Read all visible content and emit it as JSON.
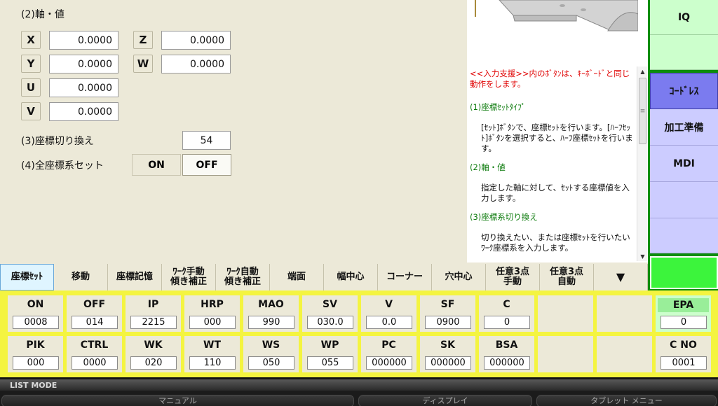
{
  "left": {
    "axis_title": "(2)軸・値",
    "axes": [
      {
        "label": "X",
        "value": "0.0000"
      },
      {
        "label": "Y",
        "value": "0.0000"
      },
      {
        "label": "U",
        "value": "0.0000"
      },
      {
        "label": "V",
        "value": "0.0000"
      },
      {
        "label": "Z",
        "value": "0.0000"
      },
      {
        "label": "W",
        "value": "0.0000"
      }
    ],
    "coord_switch_label": "(3)座標切り換え",
    "coord_switch_value": "54",
    "all_coord_label": "(4)全座標系セット",
    "on_label": "ON",
    "off_label": "OFF"
  },
  "help": {
    "intro": "<<入力支援>>内のﾎﾞﾀﾝは、ｷｰﾎﾞｰﾄﾞと同じ動作をします。",
    "sections": [
      {
        "title": "(1)座標ｾｯﾄﾀｲﾌﾟ",
        "body": "[ｾｯﾄ]ﾎﾞﾀﾝで、座標ｾｯﾄを行います。[ﾊｰﾌｾｯﾄ]ﾎﾞﾀﾝを選択すると、ﾊｰﾌ座標ｾｯﾄを行います。"
      },
      {
        "title": "(2)軸・値",
        "body": "指定した軸に対して、ｾｯﾄする座標値を入力します。"
      },
      {
        "title": "(3)座標系切り換え",
        "body": "切り換えたい、または座標ｾｯﾄを行いたいﾜｰｸ座標系を入力します。"
      }
    ]
  },
  "right": {
    "iq": "IQ",
    "codress": "ｺｰﾄﾞﾚｽ",
    "machining_prep": "加工準備",
    "mdi": "MDI"
  },
  "tabs": [
    {
      "label": "座標ｾｯﾄ",
      "active": true
    },
    {
      "label": "移動"
    },
    {
      "label": "座標記憶"
    },
    {
      "label": "ﾜｰｸ手動\n傾き補正"
    },
    {
      "label": "ﾜｰｸ自動\n傾き補正"
    },
    {
      "label": "端面"
    },
    {
      "label": "幅中心"
    },
    {
      "label": "コーナー"
    },
    {
      "label": "穴中心"
    },
    {
      "label": "任意3点\n手動"
    },
    {
      "label": "任意3点\n自動"
    },
    {
      "label": "▼"
    }
  ],
  "status": {
    "row1": [
      {
        "label": "ON",
        "value": "0008"
      },
      {
        "label": "OFF",
        "value": "014"
      },
      {
        "label": "IP",
        "value": "2215"
      },
      {
        "label": "HRP",
        "value": "000"
      },
      {
        "label": "MAO",
        "value": "990"
      },
      {
        "label": "SV",
        "value": "030.0"
      },
      {
        "label": "V",
        "value": "0.0"
      },
      {
        "label": "SF",
        "value": "0900"
      },
      {
        "label": "C",
        "value": "0"
      }
    ],
    "row2": [
      {
        "label": "PIK",
        "value": "000"
      },
      {
        "label": "CTRL",
        "value": "0000"
      },
      {
        "label": "WK",
        "value": "020"
      },
      {
        "label": "WT",
        "value": "110"
      },
      {
        "label": "WS",
        "value": "050"
      },
      {
        "label": "WP",
        "value": "055"
      },
      {
        "label": "PC",
        "value": "000000"
      },
      {
        "label": "SK",
        "value": "000000"
      },
      {
        "label": "BSA",
        "value": "000000"
      }
    ],
    "epa": {
      "label": "EPA",
      "value": "0"
    },
    "cno": {
      "label": "C NO",
      "value": "0001"
    }
  },
  "bottom": {
    "list_mode": "LIST MODE",
    "manual": "マニュアル",
    "display": "ディスプレイ",
    "tablet_menu": "タブレット メニュー"
  },
  "colors": {
    "yellow_frame": "#f4f440",
    "right_column_green": "#0c8d0c",
    "help_red": "#e00000",
    "help_green": "#0b7a0b",
    "selected_purple": "#7b7bef"
  }
}
